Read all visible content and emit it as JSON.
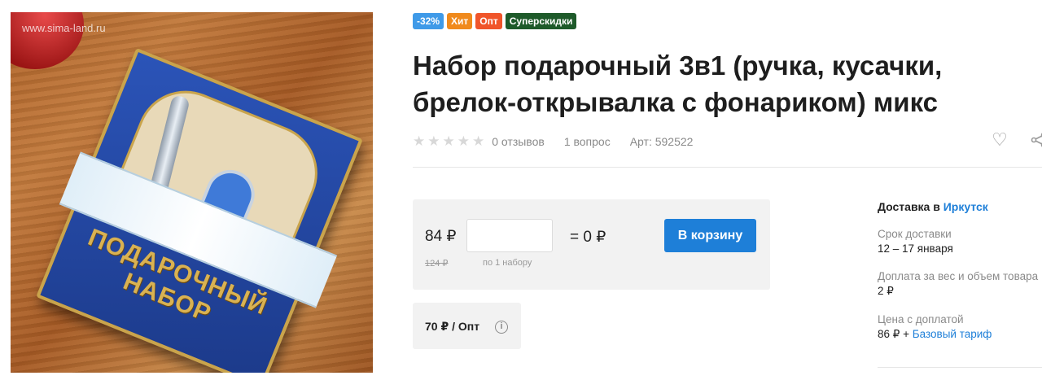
{
  "image": {
    "watermark": "www.sima-land.ru",
    "box_text": "ПОДАРОЧНЫЙ НАБОР"
  },
  "badges": [
    {
      "label": "-32%",
      "color": "#3f9ae8"
    },
    {
      "label": "Хит",
      "color": "#f08a1c"
    },
    {
      "label": "Опт",
      "color": "#f0552a"
    },
    {
      "label": "Суперскидки",
      "color": "#1e5a2a"
    }
  ],
  "product": {
    "title": "Набор подарочный 3в1 (ручка, кусачки, брелок-открывалка с фонариком) микс",
    "rating_stars": 0,
    "reviews": "0 отзывов",
    "questions": "1 вопрос",
    "article": "Арт: 592522"
  },
  "purchase": {
    "price": "84 ₽",
    "old_price": "124 ₽",
    "quantity_value": "",
    "per_set": "по 1 набору",
    "total": "= 0 ₽",
    "cart_button": "В корзину"
  },
  "wholesale": {
    "label": "70 ₽ / Опт"
  },
  "delivery": {
    "heading_prefix": "Доставка в",
    "city": "Иркутск",
    "term_label": "Срок доставки",
    "term_value": "12 – 17 января",
    "surcharge_label": "Доплата за вес и объем товара",
    "surcharge_value": "2 ₽",
    "price_label": "Цена с доплатой",
    "price_value_prefix": "86 ₽ +",
    "price_tariff": "Базовый тариф"
  },
  "colors": {
    "accent": "#1e7fd8",
    "panel": "#f2f2f2"
  }
}
